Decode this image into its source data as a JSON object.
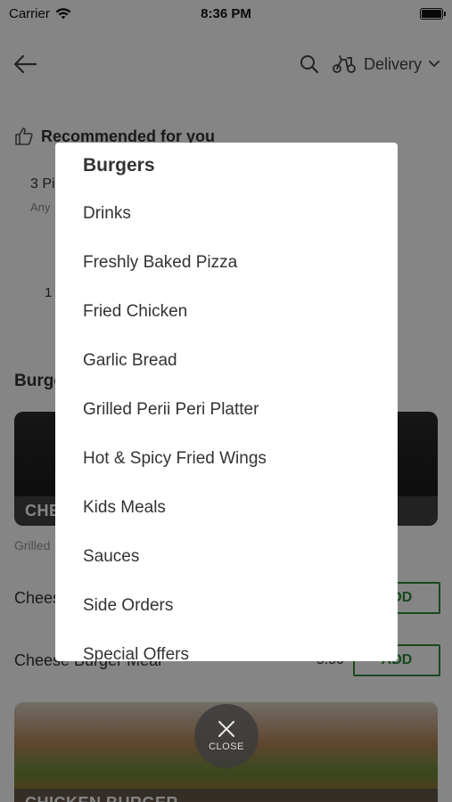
{
  "status_bar": {
    "carrier": "Carrier",
    "time": "8:36 PM"
  },
  "nav": {
    "delivery_label": "Delivery"
  },
  "recommended": {
    "title": "Recommended for you",
    "item_title": "3 Pi",
    "item_sub": "Any",
    "item_num": "1"
  },
  "category": {
    "heading": "Burge",
    "card1_label": "CHE",
    "card1_desc": "Grilled",
    "items": [
      {
        "name": "Chees",
        "price": "",
        "add_label": "ADD"
      },
      {
        "name": "Cheese Burger Meal",
        "price": "5.50",
        "add_label": "ADD"
      }
    ],
    "card2_label": "CHICKEN BURGER"
  },
  "modal": {
    "title": "Burgers",
    "items": [
      "Drinks",
      "Freshly Baked Pizza",
      "Fried Chicken",
      "Garlic Bread",
      "Grilled Perii Peri Platter",
      "Hot & Spicy Fried Wings",
      "Kids Meals",
      "Sauces",
      "Side Orders",
      "Special Offers"
    ]
  },
  "close_button": {
    "label": "CLOSE"
  },
  "colors": {
    "accent_green": "#2e8b3a",
    "overlay": "rgba(0,0,0,0.48)"
  },
  "icons": [
    "wifi-icon",
    "battery-icon",
    "back-arrow-icon",
    "search-icon",
    "scooter-icon",
    "chevron-down-icon",
    "thumbs-up-icon",
    "close-icon"
  ]
}
